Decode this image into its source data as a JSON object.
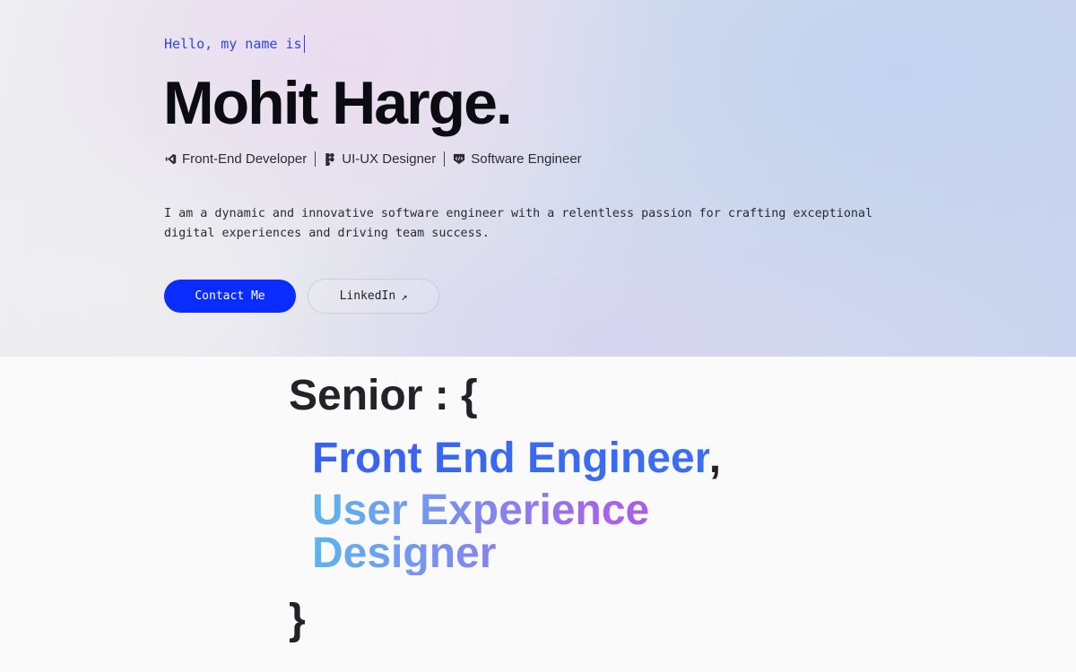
{
  "hero": {
    "greeting": "Hello, my name is",
    "name": "Mohit Harge.",
    "roles": [
      {
        "icon": "vscode-icon",
        "label": "Front-End Developer"
      },
      {
        "icon": "figma-icon",
        "label": "UI-UX Designer"
      },
      {
        "icon": "code-shield-icon",
        "label": "Software Engineer"
      }
    ],
    "description": "I am a dynamic and innovative software engineer with a relentless passion for crafting exceptional digital experiences and driving team success.",
    "contact_label": "Contact Me",
    "linkedin_label": "LinkedIn",
    "linkedin_icon": "↗"
  },
  "senior": {
    "heading": "Senior : {",
    "role_1": "Front End Engineer",
    "comma": ",",
    "role_2": "User Experience Designer",
    "closing": "}"
  },
  "colors": {
    "accent": "#0a2cff",
    "greeting": "#2f45e0",
    "gradient_blue": "#3a62f2",
    "gradient_cyan": "#5cb6ee",
    "gradient_purple": "#b056e6"
  }
}
